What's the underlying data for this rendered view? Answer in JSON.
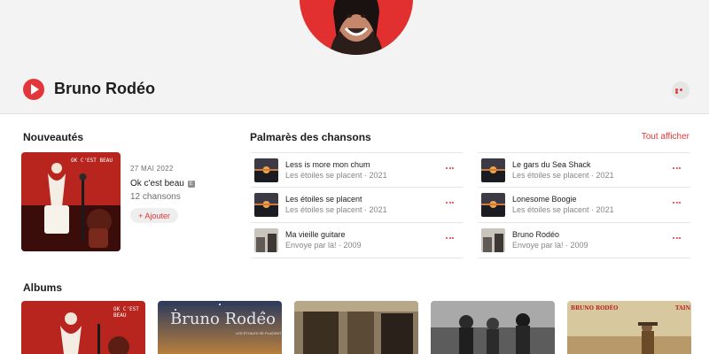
{
  "artist": {
    "name": "Bruno Rodéo"
  },
  "sections": {
    "new_releases": "Nouveautés",
    "top_songs": "Palmarès des chansons",
    "see_all": "Tout afficher",
    "albums": "Albums"
  },
  "latest_release": {
    "date": "27 MAI 2022",
    "title": "Ok c'est beau",
    "explicit_badge": "E",
    "track_count": "12 chansons",
    "add_label": "+ Ajouter",
    "cover_text": "OK C'EST BEAU"
  },
  "songs": [
    {
      "title": "Less is more mon chum",
      "subtitle": "Les étoiles se placent · 2021"
    },
    {
      "title": "Les étoiles se placent",
      "subtitle": "Les étoiles se placent · 2021"
    },
    {
      "title": "Ma vieille guitare",
      "subtitle": "Envoye par là! · 2009"
    },
    {
      "title": "Le gars du Sea Shack",
      "subtitle": "Les étoiles se placent · 2021"
    },
    {
      "title": "Lonesome Boogie",
      "subtitle": "Les étoiles se placent · 2021"
    },
    {
      "title": "Bruno Rodéo",
      "subtitle": "Envoye par là! · 2009"
    }
  ],
  "albums": [
    {
      "cover_text": "OK C'EST BEAU"
    },
    {
      "cover_text": "Bruno Rodéo",
      "cover_subtext": "LES ÉTOILES SE PLACENT"
    },
    {
      "cover_text": ""
    },
    {
      "cover_text": ""
    },
    {
      "cover_text": "BRUNO RODÉO",
      "cover_subtext": "TAIN"
    }
  ],
  "colors": {
    "accent": "#e3363b",
    "hero_bg": "#f3f3f3",
    "text": "#1d1d1f",
    "secondary": "#6e6e73"
  },
  "icons": {
    "play": "play-icon",
    "more": "ellipsis-icon"
  }
}
